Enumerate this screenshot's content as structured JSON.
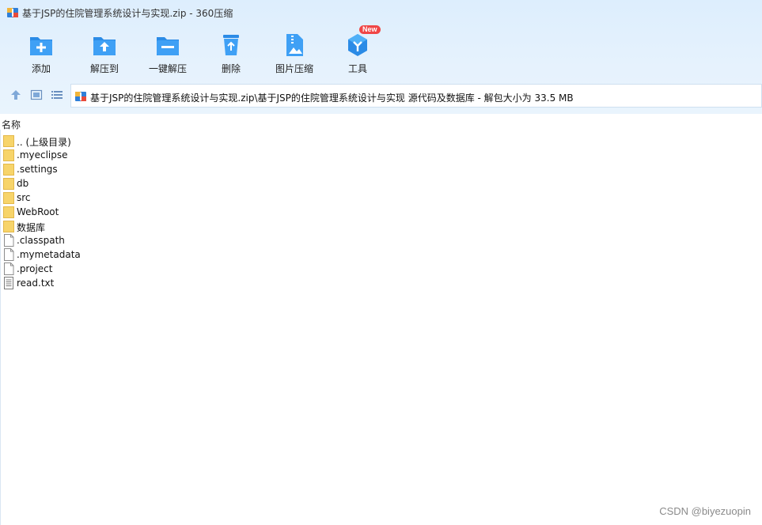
{
  "window": {
    "title": "基于JSP的住院管理系统设计与实现.zip - 360压缩",
    "app_icon": "archive-icon"
  },
  "toolbar": {
    "buttons": [
      {
        "label": "添加",
        "icon": "folder-add-icon"
      },
      {
        "label": "解压到",
        "icon": "folder-extract-icon"
      },
      {
        "label": "一键解压",
        "icon": "folder-unzip-icon"
      },
      {
        "label": "删除",
        "icon": "recycle-bin-icon"
      },
      {
        "label": "图片压缩",
        "icon": "image-compress-icon"
      },
      {
        "label": "工具",
        "icon": "tools-icon",
        "badge": "New"
      }
    ]
  },
  "nav": {
    "up_icon": "arrow-up-icon",
    "thumbnail_icon": "thumbnail-view-icon",
    "list_icon": "list-view-icon",
    "path": "基于JSP的住院管理系统设计与实现.zip\\基于JSP的住院管理系统设计与实现 源代码及数据库 - 解包大小为 33.5 MB"
  },
  "list": {
    "column_name": "名称",
    "items": [
      {
        "name": ".. (上级目录)",
        "type": "folder"
      },
      {
        "name": ".myeclipse",
        "type": "folder"
      },
      {
        "name": ".settings",
        "type": "folder"
      },
      {
        "name": "db",
        "type": "folder"
      },
      {
        "name": "src",
        "type": "folder"
      },
      {
        "name": "WebRoot",
        "type": "folder"
      },
      {
        "name": "数据库",
        "type": "folder"
      },
      {
        "name": ".classpath",
        "type": "file"
      },
      {
        "name": ".mymetadata",
        "type": "file"
      },
      {
        "name": ".project",
        "type": "file"
      },
      {
        "name": "read.txt",
        "type": "text"
      }
    ]
  },
  "watermark": "CSDN @biyezuopin",
  "colors": {
    "accent_blue": "#2b8be6",
    "folder_yellow": "#f7d46a",
    "badge_red": "#f04646",
    "chrome_bg": "#e6f2fd"
  }
}
